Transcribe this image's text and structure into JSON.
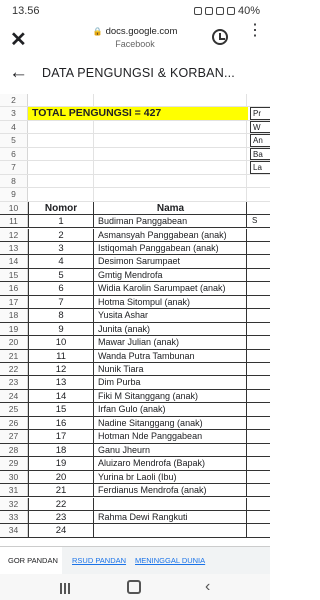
{
  "status_bar": {
    "time": "13.56",
    "battery": "40%"
  },
  "browser": {
    "close_icon": "close-icon",
    "lock_icon": "lock-icon",
    "domain": "docs.google.com",
    "site_name": "Facebook"
  },
  "sheet": {
    "title": "DATA PENGUNGSI & KORBAN..."
  },
  "row_numbers": [
    "2",
    "3",
    "4",
    "5",
    "6",
    "7",
    "8",
    "9",
    "10",
    "11",
    "12",
    "13",
    "14",
    "15",
    "16",
    "17",
    "18",
    "19",
    "20",
    "21",
    "22",
    "23",
    "24",
    "25",
    "26",
    "27",
    "28",
    "29",
    "30",
    "31",
    "32",
    "33",
    "34"
  ],
  "total_label": "TOTAL PENGUNGSI = 427",
  "side_column": {
    "row3": "Pr",
    "row4": "W",
    "row5": "An",
    "row6": "Ba",
    "row7": "La",
    "row11": "S"
  },
  "table": {
    "header_nomor": "Nomor",
    "header_nama": "Nama",
    "rows": [
      {
        "no": "1",
        "name": "Budiman Panggabean"
      },
      {
        "no": "2",
        "name": "Asmansyah Panggabean (anak)"
      },
      {
        "no": "3",
        "name": "Istiqomah Panggabean (anak)"
      },
      {
        "no": "4",
        "name": "Desimon Sarumpaet"
      },
      {
        "no": "5",
        "name": "Gmtig Mendrofa"
      },
      {
        "no": "6",
        "name": "Widia Karolin Sarumpaet (anak)"
      },
      {
        "no": "7",
        "name": "Hotma Sitompul (anak)"
      },
      {
        "no": "8",
        "name": "Yusita Ashar"
      },
      {
        "no": "9",
        "name": "Junita (anak)"
      },
      {
        "no": "10",
        "name": "Mawar Julian (anak)"
      },
      {
        "no": "11",
        "name": "Wanda Putra Tambunan"
      },
      {
        "no": "12",
        "name": "Nunik Tiara"
      },
      {
        "no": "13",
        "name": "Dim Purba"
      },
      {
        "no": "14",
        "name": "Fiki M Sitanggang (anak)"
      },
      {
        "no": "15",
        "name": "Irfan Gulo (anak)"
      },
      {
        "no": "16",
        "name": "Nadine Sitanggang (anak)"
      },
      {
        "no": "17",
        "name": "Hotman Nde Panggabean"
      },
      {
        "no": "18",
        "name": "Ganu Jheurn"
      },
      {
        "no": "19",
        "name": "Aluizaro Mendrofa (Bapak)"
      },
      {
        "no": "20",
        "name": "Yurina br Laoli (Ibu)"
      },
      {
        "no": "21",
        "name": "Ferdianus Mendrofa (anak)"
      },
      {
        "no": "22",
        "name": ""
      },
      {
        "no": "23",
        "name": "Rahma Dewi Rangkuti"
      },
      {
        "no": "24",
        "name": ""
      }
    ]
  },
  "tabs": [
    {
      "label": "GOR PANDAN",
      "active": true
    },
    {
      "label": "RSUD PANDAN",
      "active": false
    },
    {
      "label": "MENINGGAL DUNIA",
      "active": false
    }
  ],
  "colors": {
    "highlight": "#ffff00",
    "link": "#1a73e8"
  }
}
